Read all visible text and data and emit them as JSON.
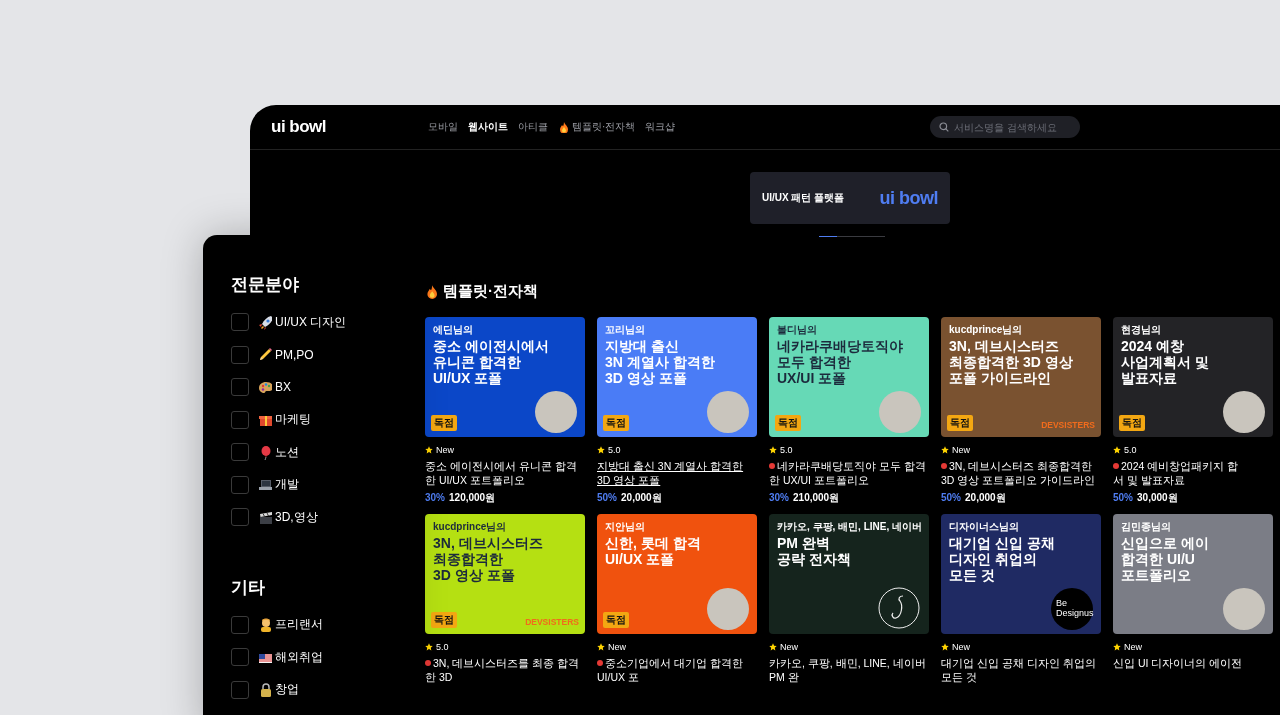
{
  "window": {
    "logo": "ui bowl"
  },
  "nav": [
    {
      "label": "모바일",
      "selected": false,
      "kind": "plain"
    },
    {
      "label": "웹사이트",
      "selected": true,
      "kind": "plain"
    },
    {
      "label": "아티클",
      "selected": false,
      "kind": "plain"
    },
    {
      "label": "템플릿·전자책",
      "selected": false,
      "kind": "fire"
    },
    {
      "label": "워크샵",
      "selected": false,
      "kind": "plain"
    }
  ],
  "search": {
    "placeholder": "서비스명을 검색하세요"
  },
  "banner": {
    "caption": "UI/UX 패턴 플랫폼",
    "logo": "ui bowl",
    "indicator": {
      "level": 0.27
    }
  },
  "section": {
    "title": "템플릿·전자책",
    "rows": [
      [
        {
          "author": "에딘님의",
          "headline": "중소 에이전시에서\n유니콘 합격한\nUI/UX 포폴",
          "color": "#0b47c8",
          "badge": "독점",
          "kind": "photo",
          "rating": "New",
          "pinned": false,
          "underlined": false,
          "title": "중소 에이전시에서 유니콘 합격한 UI/UX 포트폴리오",
          "discount": "30%",
          "price": "120,000원"
        },
        {
          "author": "꼬리님의",
          "headline": "지방대 출신\n3N 계열사 합격한\n3D 영상 포폴",
          "color": "#4a7cf6",
          "badge": "독점",
          "kind": "photo",
          "rating": "5.0",
          "pinned": false,
          "underlined": true,
          "title": "지방대 출신 3N 계열사 합격한 3D 영상 포폴",
          "discount": "50%",
          "price": "20,000원"
        },
        {
          "author": "볼디님의",
          "headline": "네카라쿠배당토직야\n모두 합격한\nUX/UI 포폴",
          "color": "#66d9b6",
          "badge": "독점",
          "kind": "photo",
          "rating": "5.0",
          "pinned": true,
          "underlined": false,
          "title": "네카라쿠배당토직야 모두 합격한 UX/UI 포트폴리오",
          "discount": "30%",
          "price": "210,000원"
        },
        {
          "author": "kucdprince님의",
          "headline": "3N, 데브시스터즈\n최종합격한 3D 영상\n포폴 가이드라인",
          "color": "#7a5230",
          "badge": "독점",
          "brand": "DEVSISTERS",
          "kind": "plain",
          "rating": "New",
          "pinned": true,
          "underlined": false,
          "title": "3N, 데브시스터즈 최종합격한 3D 영상 포트폴리오 가이드라인",
          "discount": "50%",
          "price": "20,000원"
        },
        {
          "author": "현경님의",
          "headline": "2024 예창\n사업계획서 및\n발표자료",
          "color": "#232326",
          "badge": "독점",
          "kind": "photo",
          "rating": "5.0",
          "pinned": true,
          "underlined": false,
          "title": "2024 예비창업패키지 합\n서 및 발표자료",
          "discount": "50%",
          "price": "30,000원"
        }
      ],
      [
        {
          "author": "kucdprince님의",
          "headline": "3N, 데브시스터즈\n최종합격한\n3D 영상 포폴",
          "color": "#b5e012",
          "badge": "독점",
          "brand": "DEVSISTERS",
          "kind": "plain",
          "rating": "5.0",
          "pinned": true,
          "underlined": false,
          "title": "3N, 데브시스터즈를 최종 합격한 3D"
        },
        {
          "author": "지안님의",
          "headline": "신한, 롯데 합격\nUI/UX 포폴",
          "color": "#f0520e",
          "badge": "독점",
          "kind": "photo",
          "rating": "New",
          "pinned": true,
          "underlined": false,
          "title": "중소기업에서 대기업 합격한 UI/UX 포"
        },
        {
          "author": "카카오, 쿠팡, 배민, LINE, 네이버",
          "headline": "PM 완벽\n공략 전자책",
          "color": "#15241d",
          "kind": "signature",
          "rating": "New",
          "pinned": false,
          "underlined": false,
          "title": "카카오, 쿠팡, 배민, LINE, 네이버 PM 완"
        },
        {
          "author": "디자이너스님의",
          "headline": "대기업 신입 공채\n디자인 취업의\n모든 것",
          "color": "#1f2a63",
          "kind": "logo",
          "logo_lines": [
            "Be",
            "Designus"
          ],
          "rating": "New",
          "pinned": false,
          "underlined": false,
          "title": "대기업 신입 공채 디자인 취업의 모든 것"
        },
        {
          "author": "김민종님의",
          "headline": "신입으로 에이\n합격한 UI/U\n포트폴리오",
          "color": "#7b7d86",
          "kind": "photo",
          "rating": "New",
          "pinned": false,
          "underlined": false,
          "title": "신입 UI 디자이너의 에이전"
        }
      ]
    ]
  },
  "filters": [
    {
      "heading": "전문분야",
      "items": [
        {
          "label": "UI/UX 디자인",
          "checked": false
        },
        {
          "label": "PM,PO",
          "checked": false
        },
        {
          "label": "BX",
          "checked": false
        },
        {
          "label": "마케팅",
          "checked": false
        },
        {
          "label": "노션",
          "checked": false
        },
        {
          "label": "개발",
          "checked": false
        },
        {
          "label": "3D,영상",
          "checked": false
        }
      ]
    },
    {
      "heading": "기타",
      "items": [
        {
          "label": "프리랜서",
          "checked": false
        },
        {
          "label": "해외취업",
          "checked": false
        },
        {
          "label": "창업",
          "checked": false
        }
      ]
    }
  ]
}
